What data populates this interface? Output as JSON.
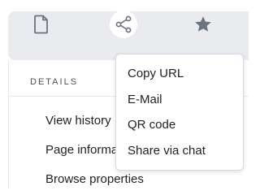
{
  "toolbar": {
    "buttons": [
      {
        "icon": "page-icon"
      },
      {
        "icon": "share-icon"
      },
      {
        "icon": "star-icon"
      }
    ]
  },
  "details": {
    "title": "DETAILS",
    "items": [
      "View history",
      "Page informa",
      "Browse properties"
    ]
  },
  "share_menu": {
    "items": [
      "Copy URL",
      "E-Mail",
      "QR code",
      "Share via chat"
    ]
  },
  "colors": {
    "toolbar_bg": "#e9ebef",
    "icon": "#6b7280",
    "text": "#222222"
  }
}
